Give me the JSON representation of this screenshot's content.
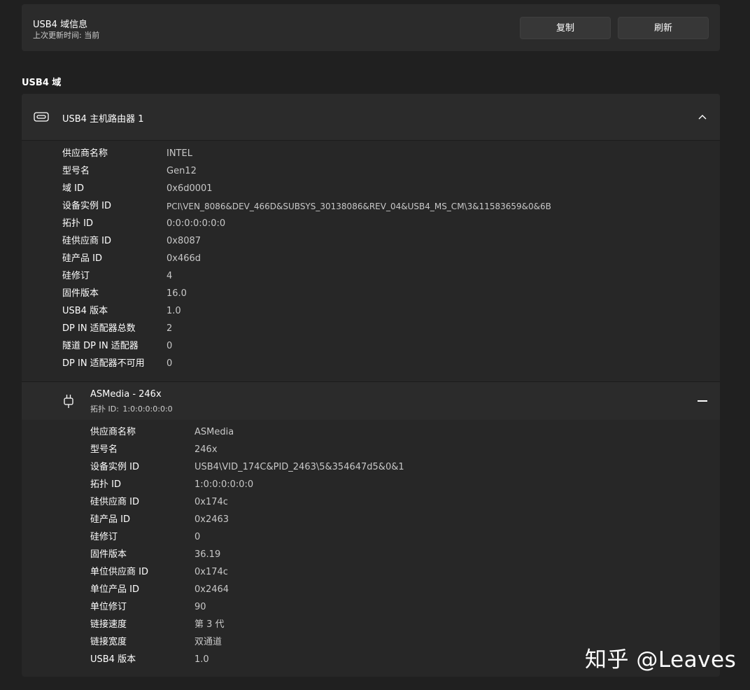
{
  "info_card": {
    "title": "USB4 域信息",
    "last_updated_label": "上次更新时间:",
    "last_updated_value": "当前",
    "copy_button": "复制",
    "refresh_button": "刷新"
  },
  "section_title": "USB4 域",
  "router": {
    "icon": "usb-c-port-icon",
    "title": "USB4 主机路由器 1",
    "expanded": true,
    "properties": [
      {
        "label": "供应商名称",
        "value": "INTEL"
      },
      {
        "label": "型号名",
        "value": "Gen12"
      },
      {
        "label": "域 ID",
        "value": "0x6d0001"
      },
      {
        "label": "设备实例 ID",
        "value": "PCI\\VEN_8086&DEV_466D&SUBSYS_30138086&REV_04&USB4_MS_CM\\3&11583659&0&6B"
      },
      {
        "label": "拓扑 ID",
        "value": "0:0:0:0:0:0:0"
      },
      {
        "label": "硅供应商 ID",
        "value": "0x8087"
      },
      {
        "label": "硅产品 ID",
        "value": "0x466d"
      },
      {
        "label": "硅修订",
        "value": "4"
      },
      {
        "label": "固件版本",
        "value": "16.0"
      },
      {
        "label": "USB4 版本",
        "value": "1.0"
      },
      {
        "label": "DP IN 适配器总数",
        "value": "2"
      },
      {
        "label": "隧道 DP IN 适配器",
        "value": "0"
      },
      {
        "label": "DP IN 适配器不可用",
        "value": "0"
      }
    ]
  },
  "device": {
    "icon": "usb-plug-icon",
    "title": "ASMedia - 246x",
    "topology_label": "拓扑 ID:",
    "topology_value": "1:0:0:0:0:0:0",
    "properties": [
      {
        "label": "供应商名称",
        "value": "ASMedia"
      },
      {
        "label": "型号名",
        "value": "246x"
      },
      {
        "label": "设备实例 ID",
        "value": "USB4\\VID_174C&PID_2463\\5&354647d5&0&1"
      },
      {
        "label": "拓扑 ID",
        "value": "1:0:0:0:0:0:0"
      },
      {
        "label": "硅供应商 ID",
        "value": "0x174c"
      },
      {
        "label": "硅产品 ID",
        "value": "0x2463"
      },
      {
        "label": "硅修订",
        "value": "0"
      },
      {
        "label": "固件版本",
        "value": "36.19"
      },
      {
        "label": "单位供应商 ID",
        "value": "0x174c"
      },
      {
        "label": "单位产品 ID",
        "value": "0x2464"
      },
      {
        "label": "单位修订",
        "value": "90"
      },
      {
        "label": "链接速度",
        "value": "第 3 代"
      },
      {
        "label": "链接宽度",
        "value": "双通道"
      },
      {
        "label": "USB4 版本",
        "value": "1.0"
      }
    ]
  },
  "watermark": "知乎 @Leaves"
}
